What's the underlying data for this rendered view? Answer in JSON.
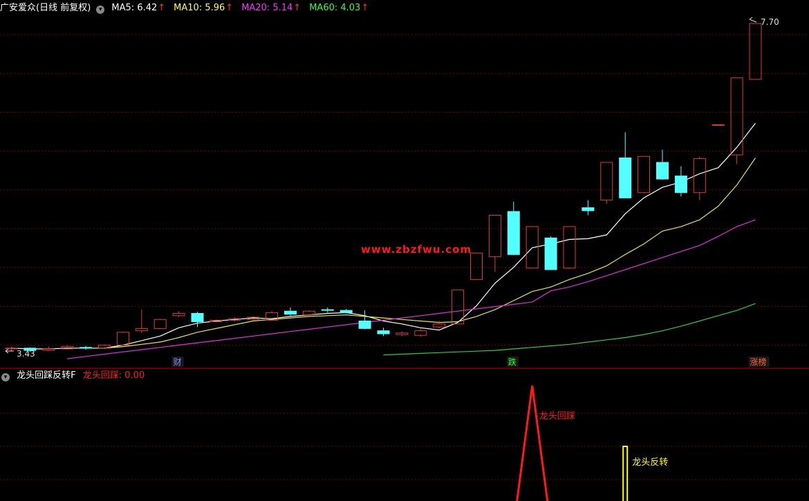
{
  "header": {
    "title": "广安爱众(日线 前复权)",
    "ma": [
      {
        "label": "MA5: 6.42",
        "color": "#ffffff"
      },
      {
        "label": "MA10: 5.96",
        "color": "#ffff33"
      },
      {
        "label": "MA20: 5.14",
        "color": "#ff33ff"
      },
      {
        "label": "MA60: 4.03",
        "color": "#33ff33"
      }
    ],
    "up_arrow": "↑"
  },
  "indicator_header": {
    "name": "龙头回踩反转F",
    "value_label": "龙头回踩: 0.00",
    "value_color": "#ff2020"
  },
  "watermark": "www.zbzfwu.com",
  "price_labels": {
    "high": "7.70",
    "low": "3.43"
  },
  "event_tags": [
    {
      "text": "财",
      "candle": 9,
      "color": "#8888ff"
    },
    {
      "text": "跌",
      "candle": 27,
      "color": "#33ff33"
    },
    {
      "text": "涨榜",
      "candle": 40,
      "color": "#ff6633"
    }
  ],
  "colors": {
    "up": "#e23a3a",
    "down": "#54ffff",
    "grid": "#7a0000",
    "separator": "#cc0000",
    "signal_red": "#ff1a1a",
    "signal_yellow": "#ffff00"
  },
  "chart_data": {
    "type": "candlestick",
    "series_type": "daily OHLC",
    "ylim": [
      3.2,
      7.85
    ],
    "candles": [
      [
        3.43,
        3.46,
        3.4,
        3.44
      ],
      [
        3.44,
        3.45,
        3.39,
        3.41
      ],
      [
        3.41,
        3.46,
        3.4,
        3.43
      ],
      [
        3.43,
        3.48,
        3.42,
        3.46
      ],
      [
        3.45,
        3.47,
        3.42,
        3.44
      ],
      [
        3.44,
        3.49,
        3.43,
        3.48
      ],
      [
        3.48,
        3.66,
        3.47,
        3.65
      ],
      [
        3.67,
        3.95,
        3.64,
        3.7
      ],
      [
        3.7,
        3.83,
        3.69,
        3.82
      ],
      [
        3.87,
        3.93,
        3.85,
        3.9
      ],
      [
        3.9,
        3.92,
        3.72,
        3.79
      ],
      [
        3.79,
        3.82,
        3.78,
        3.81
      ],
      [
        3.81,
        3.85,
        3.79,
        3.83
      ],
      [
        3.82,
        3.86,
        3.8,
        3.85
      ],
      [
        3.81,
        3.93,
        3.8,
        3.91
      ],
      [
        3.93,
        3.98,
        3.87,
        3.89
      ],
      [
        3.88,
        3.94,
        3.87,
        3.93
      ],
      [
        3.95,
        3.98,
        3.91,
        3.94
      ],
      [
        3.94,
        3.96,
        3.9,
        3.91
      ],
      [
        3.8,
        3.94,
        3.69,
        3.7
      ],
      [
        3.67,
        3.71,
        3.6,
        3.63
      ],
      [
        3.62,
        3.66,
        3.6,
        3.64
      ],
      [
        3.61,
        3.7,
        3.59,
        3.67
      ],
      [
        3.72,
        3.8,
        3.7,
        3.76
      ],
      [
        3.76,
        4.21,
        3.75,
        4.21
      ],
      [
        4.35,
        4.7,
        4.35,
        4.7
      ],
      [
        4.65,
        5.2,
        4.45,
        5.2
      ],
      [
        5.25,
        5.38,
        4.67,
        4.68
      ],
      [
        4.5,
        5.05,
        4.5,
        5.05
      ],
      [
        4.9,
        4.92,
        4.48,
        4.48
      ],
      [
        4.5,
        5.05,
        4.49,
        5.05
      ],
      [
        5.3,
        5.4,
        5.2,
        5.26
      ],
      [
        5.4,
        5.9,
        5.35,
        5.9
      ],
      [
        5.96,
        6.3,
        5.43,
        5.43
      ],
      [
        5.5,
        5.98,
        5.49,
        5.98
      ],
      [
        5.9,
        6.07,
        5.67,
        5.68
      ],
      [
        5.72,
        5.85,
        5.45,
        5.5
      ],
      [
        5.5,
        5.98,
        5.4,
        5.95
      ],
      [
        6.4,
        6.4,
        6.4,
        6.4
      ],
      [
        6.0,
        7.02,
        5.88,
        7.02
      ],
      [
        7.0,
        7.74,
        7.0,
        7.74
      ]
    ],
    "ma5": [
      3.44,
      3.43,
      3.43,
      3.44,
      3.44,
      3.44,
      3.48,
      3.54,
      3.6,
      3.71,
      3.77,
      3.8,
      3.82,
      3.84,
      3.83,
      3.86,
      3.88,
      3.9,
      3.91,
      3.87,
      3.8,
      3.76,
      3.71,
      3.68,
      3.78,
      4.0,
      4.3,
      4.51,
      4.77,
      4.82,
      4.88,
      4.89,
      4.94,
      5.22,
      5.43,
      5.57,
      5.64,
      5.75,
      5.83,
      6.1,
      6.42
    ],
    "ma10": [
      null,
      null,
      null,
      null,
      null,
      3.44,
      3.46,
      3.49,
      3.52,
      3.58,
      3.65,
      3.7,
      3.75,
      3.8,
      3.82,
      3.84,
      3.86,
      3.87,
      3.88,
      3.86,
      3.84,
      3.82,
      3.8,
      3.78,
      3.79,
      3.86,
      3.95,
      4.07,
      4.19,
      4.25,
      4.35,
      4.43,
      4.53,
      4.68,
      4.82,
      4.99,
      5.05,
      5.14,
      5.32,
      5.6,
      5.96
    ],
    "ma20": [
      null,
      null,
      null,
      null,
      null,
      null,
      null,
      null,
      null,
      null,
      null,
      null,
      null,
      null,
      null,
      null,
      null,
      null,
      null,
      null,
      null,
      null,
      null,
      null,
      null,
      null,
      null,
      null,
      null,
      4.2,
      4.25,
      4.32,
      4.4,
      4.48,
      4.56,
      4.64,
      4.72,
      4.8,
      4.92,
      5.05,
      5.14
    ],
    "ma60": [
      null,
      null,
      null,
      null,
      null,
      null,
      null,
      null,
      null,
      null,
      null,
      null,
      null,
      null,
      null,
      null,
      null,
      null,
      null,
      null,
      null,
      null,
      null,
      null,
      null,
      null,
      null,
      null,
      null,
      null,
      null,
      null,
      null,
      null,
      null,
      null,
      null,
      null,
      null,
      null,
      null,
      null,
      null,
      null,
      null,
      null
    ],
    "ma60_values": [
      3.35,
      3.36,
      3.37,
      3.38,
      3.39,
      3.4,
      3.41,
      3.43,
      3.45,
      3.47,
      3.49,
      3.52,
      3.55,
      3.58,
      3.62,
      3.67,
      3.73,
      3.8,
      3.87,
      3.94,
      4.03
    ],
    "indicator": {
      "name": "龙头回踩反转F",
      "ylim": [
        0,
        1
      ],
      "huitai_label": "龙头回踩",
      "fanzhuan_label": "龙头反转",
      "huitai_candle": 28,
      "fanzhuan_candle": 33
    }
  }
}
